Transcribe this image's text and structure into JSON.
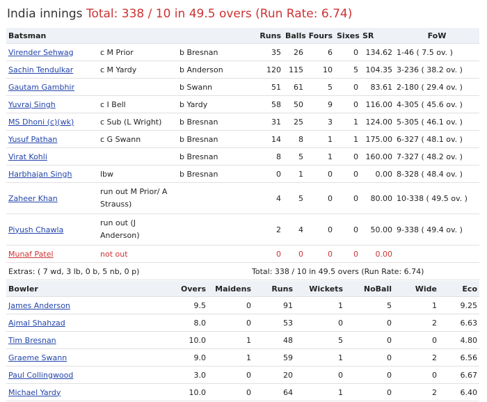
{
  "heading": {
    "team": "India innings",
    "total": "Total: 338 / 10 in 49.5 overs (Run Rate: 6.74)"
  },
  "batting": {
    "headers": {
      "batsman": "Batsman",
      "runs": "Runs",
      "balls": "Balls",
      "fours": "Fours",
      "sixes": "Sixes",
      "sr": "SR",
      "fow": "FoW"
    },
    "rows": [
      {
        "name": "Virender Sehwag",
        "dismissal": "c M Prior",
        "bowler": "b Bresnan",
        "runs": "35",
        "balls": "26",
        "fours": "6",
        "sixes": "0",
        "sr": "134.62",
        "fow": "1-46 ( 7.5 ov. )"
      },
      {
        "name": "Sachin Tendulkar",
        "dismissal": "c M Yardy",
        "bowler": "b Anderson",
        "runs": "120",
        "balls": "115",
        "fours": "10",
        "sixes": "5",
        "sr": "104.35",
        "fow": "3-236 ( 38.2 ov. )"
      },
      {
        "name": "Gautam Gambhir",
        "dismissal": "",
        "bowler": "b Swann",
        "runs": "51",
        "balls": "61",
        "fours": "5",
        "sixes": "0",
        "sr": "83.61",
        "fow": "2-180 ( 29.4 ov. )"
      },
      {
        "name": "Yuvraj Singh",
        "dismissal": "c I Bell",
        "bowler": "b Yardy",
        "runs": "58",
        "balls": "50",
        "fours": "9",
        "sixes": "0",
        "sr": "116.00",
        "fow": "4-305 ( 45.6 ov. )"
      },
      {
        "name": "MS Dhoni (c)(wk)",
        "dismissal": "c Sub (L Wright)",
        "bowler": "b Bresnan",
        "runs": "31",
        "balls": "25",
        "fours": "3",
        "sixes": "1",
        "sr": "124.00",
        "fow": "5-305 ( 46.1 ov. )"
      },
      {
        "name": "Yusuf Pathan",
        "dismissal": "c G Swann",
        "bowler": "b Bresnan",
        "runs": "14",
        "balls": "8",
        "fours": "1",
        "sixes": "1",
        "sr": "175.00",
        "fow": "6-327 ( 48.1 ov. )"
      },
      {
        "name": "Virat Kohli",
        "dismissal": "",
        "bowler": "b Bresnan",
        "runs": "8",
        "balls": "5",
        "fours": "1",
        "sixes": "0",
        "sr": "160.00",
        "fow": "7-327 ( 48.2 ov. )"
      },
      {
        "name": "Harbhajan Singh",
        "dismissal": "lbw",
        "bowler": "b Bresnan",
        "runs": "0",
        "balls": "1",
        "fours": "0",
        "sixes": "0",
        "sr": "0.00",
        "fow": "8-328 ( 48.4 ov. )"
      },
      {
        "name": "Zaheer Khan",
        "dismissal": "run out M Prior/ A Strauss)",
        "bowler": "",
        "runs": "4",
        "balls": "5",
        "fours": "0",
        "sixes": "0",
        "sr": "80.00",
        "fow": "10-338 ( 49.5 ov. )"
      },
      {
        "name": "Piyush Chawla",
        "dismissal": "run out (J Anderson)",
        "bowler": "",
        "runs": "2",
        "balls": "4",
        "fours": "0",
        "sixes": "0",
        "sr": "50.00",
        "fow": "9-338 ( 49.4 ov. )"
      },
      {
        "name": "Munaf Patel",
        "dismissal": "not out",
        "bowler": "",
        "runs": "0",
        "balls": "0",
        "fours": "0",
        "sixes": "0",
        "sr": "0.00",
        "fow": ""
      }
    ],
    "extras": "Extras: ( 7 wd, 3 lb, 0 b, 5 nb, 0 p)",
    "total": "Total: 338 / 10 in 49.5 overs (Run Rate: 6.74)"
  },
  "bowling": {
    "headers": {
      "bowler": "Bowler",
      "overs": "Overs",
      "maidens": "Maidens",
      "runs": "Runs",
      "wickets": "Wickets",
      "noball": "NoBall",
      "wide": "Wide",
      "eco": "Eco"
    },
    "rows": [
      {
        "name": "James Anderson",
        "overs": "9.5",
        "maidens": "0",
        "runs": "91",
        "wickets": "1",
        "noball": "5",
        "wide": "1",
        "eco": "9.25"
      },
      {
        "name": "Ajmal Shahzad",
        "overs": "8.0",
        "maidens": "0",
        "runs": "53",
        "wickets": "0",
        "noball": "0",
        "wide": "2",
        "eco": "6.63"
      },
      {
        "name": "Tim Bresnan",
        "overs": "10.0",
        "maidens": "1",
        "runs": "48",
        "wickets": "5",
        "noball": "0",
        "wide": "0",
        "eco": "4.80"
      },
      {
        "name": "Graeme Swann",
        "overs": "9.0",
        "maidens": "1",
        "runs": "59",
        "wickets": "1",
        "noball": "0",
        "wide": "2",
        "eco": "6.56"
      },
      {
        "name": "Paul Collingwood",
        "overs": "3.0",
        "maidens": "0",
        "runs": "20",
        "wickets": "0",
        "noball": "0",
        "wide": "0",
        "eco": "6.67"
      },
      {
        "name": "Michael Yardy",
        "overs": "10.0",
        "maidens": "0",
        "runs": "64",
        "wickets": "1",
        "noball": "0",
        "wide": "2",
        "eco": "6.40"
      }
    ]
  },
  "colors": {
    "link": "#2244aa",
    "total": "#cc3333",
    "notout": "#cc3333",
    "header_bg": "#eef2f7"
  }
}
